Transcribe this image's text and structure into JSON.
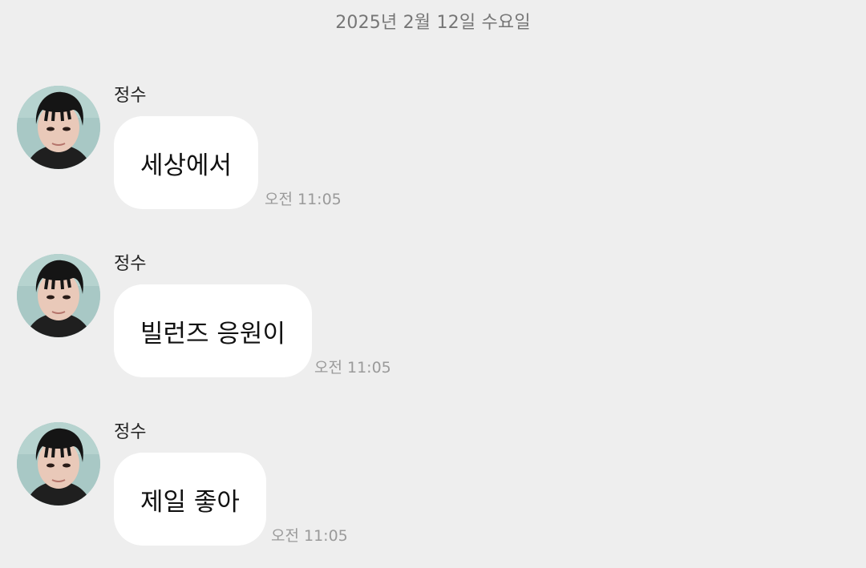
{
  "date_divider": "2025년 2월 12일 수요일",
  "messages": [
    {
      "sender": "정수",
      "text": "세상에서",
      "time": "오전 11:05"
    },
    {
      "sender": "정수",
      "text": "빌런즈 응원이",
      "time": "오전 11:05"
    },
    {
      "sender": "정수",
      "text": "제일 좋아",
      "time": "오전 11:05"
    }
  ],
  "icons": {
    "avatar": "profile-photo"
  },
  "colors": {
    "background": "#eeeeee",
    "bubble": "#ffffff",
    "timestamp": "#9a9a9a",
    "date_divider": "#767676"
  }
}
